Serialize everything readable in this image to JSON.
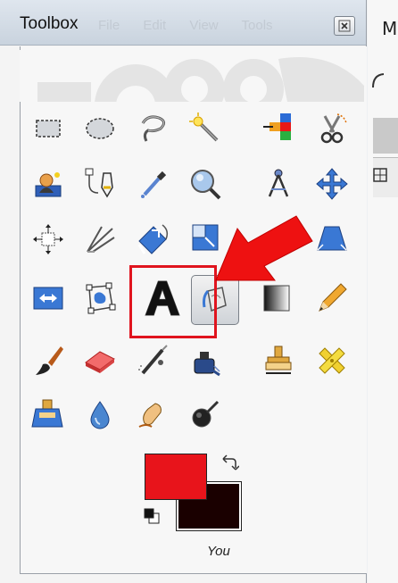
{
  "window": {
    "title": "Toolbox",
    "ghost_menu": [
      "File",
      "Edit",
      "View",
      "Tools"
    ],
    "close_icon": "close-icon",
    "background_app_letter": "M"
  },
  "tools": [
    {
      "name": "rect-select-icon",
      "interactable": true
    },
    {
      "name": "ellipse-select-icon",
      "interactable": true
    },
    {
      "name": "free-select-icon",
      "interactable": true
    },
    {
      "name": "fuzzy-select-icon",
      "interactable": true
    },
    {
      "name": "by-color-select-icon",
      "interactable": true
    },
    {
      "name": "scissors-select-icon",
      "interactable": true
    },
    {
      "name": "foreground-select-icon",
      "interactable": true
    },
    {
      "name": "paths-icon",
      "interactable": true
    },
    {
      "name": "color-picker-icon",
      "interactable": true
    },
    {
      "name": "magnify-icon",
      "interactable": true
    },
    {
      "name": "measure-icon",
      "interactable": true
    },
    {
      "name": "move-icon",
      "interactable": true
    },
    {
      "name": "align-icon",
      "interactable": true
    },
    {
      "name": "crop-icon",
      "interactable": true
    },
    {
      "name": "rotate-icon",
      "interactable": true
    },
    {
      "name": "scale-icon",
      "interactable": true
    },
    {
      "name": "shear-icon",
      "interactable": true
    },
    {
      "name": "perspective-icon",
      "interactable": true
    },
    {
      "name": "flip-icon",
      "interactable": true
    },
    {
      "name": "cage-transform-icon",
      "interactable": true
    },
    {
      "name": "text-tool-icon",
      "interactable": true
    },
    {
      "name": "bucket-fill-icon",
      "interactable": true,
      "active": true
    },
    {
      "name": "blend-icon",
      "interactable": true
    },
    {
      "name": "pencil-icon",
      "interactable": true
    },
    {
      "name": "paintbrush-icon",
      "interactable": true
    },
    {
      "name": "eraser-icon",
      "interactable": true
    },
    {
      "name": "airbrush-icon",
      "interactable": true
    },
    {
      "name": "ink-icon",
      "interactable": true
    },
    {
      "name": "clone-icon",
      "interactable": true
    },
    {
      "name": "heal-icon",
      "interactable": true
    },
    {
      "name": "perspective-clone-icon",
      "interactable": true
    },
    {
      "name": "blur-sharpen-icon",
      "interactable": true
    },
    {
      "name": "smudge-icon",
      "interactable": true
    },
    {
      "name": "dodge-burn-icon",
      "interactable": true
    }
  ],
  "colors": {
    "foreground": "#e8141b",
    "background": "#1a0000",
    "highlight": "#e0141e",
    "arrow": "#ee1111"
  },
  "footer": {
    "brush_name": "You"
  }
}
